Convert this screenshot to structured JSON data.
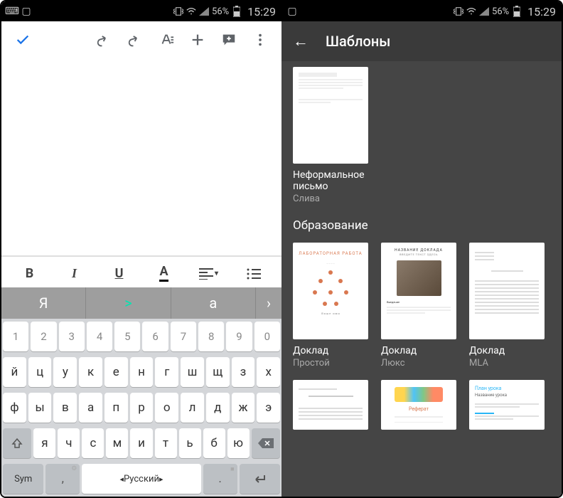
{
  "status": {
    "battery": "56%",
    "time": "15:29"
  },
  "left": {
    "format": {
      "bold": "B",
      "italic": "I",
      "underline": "U",
      "color": "A"
    },
    "suggest": {
      "s1": "Я",
      "s2": ">",
      "s3": "а"
    },
    "keys": {
      "n1": "1",
      "n2": "2",
      "n3": "3",
      "n4": "4",
      "n5": "5",
      "n6": "6",
      "n7": "7",
      "n8": "8",
      "n9": "9",
      "n0": "0",
      "r2": [
        "й",
        "ц",
        "у",
        "к",
        "е",
        "н",
        "г",
        "ш",
        "щ",
        "з",
        "х"
      ],
      "r3": [
        "ф",
        "ы",
        "в",
        "а",
        "п",
        "р",
        "о",
        "л",
        "д",
        "ж",
        "э"
      ],
      "r4": [
        "я",
        "ч",
        "с",
        "м",
        "и",
        "т",
        "ь",
        "б",
        "ю"
      ],
      "sym": "Sym",
      "space": "Русский"
    }
  },
  "right": {
    "title": "Шаблоны",
    "top_tmpl": {
      "title": "Неформальное письмо",
      "sub": "Слива"
    },
    "section": "Образование",
    "row1": [
      {
        "title": "Доклад",
        "sub": "Простой",
        "thumb_title": "ЛАБОРАТОРНАЯ РАБОТА"
      },
      {
        "title": "Доклад",
        "sub": "Люкс",
        "thumb_title": "НАЗВАНИЕ ДОКЛАДА",
        "thumb_sub": "ВВЕДИТЕ ТЕКСТ ЗДЕСЬ"
      },
      {
        "title": "Доклад",
        "sub": "MLA"
      }
    ],
    "row2": [
      {
        "thumb_title": ""
      },
      {
        "thumb_title": "Реферат"
      },
      {
        "thumb_title": "План урока",
        "thumb_sub": "Название урока"
      }
    ]
  }
}
